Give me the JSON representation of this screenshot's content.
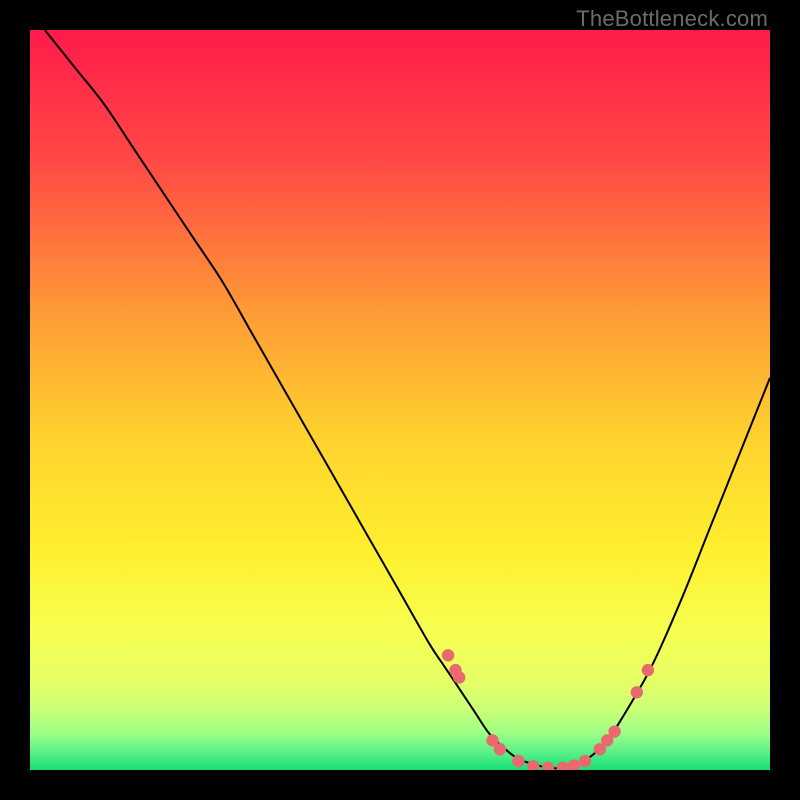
{
  "watermark": "TheBottleneck.com",
  "colors": {
    "frame": "#000000",
    "curve": "#000000",
    "dot_fill": "#e86a6f",
    "dot_stroke": "#d84a50",
    "grad_top": "#ff1b4b",
    "grad_mid1": "#ff6a3a",
    "grad_mid2": "#ffb92e",
    "grad_mid3": "#ffe531",
    "grad_mid4": "#f7ff4d",
    "grad_mid5": "#d8ff70",
    "grad_bottom": "#16e072"
  },
  "chart_data": {
    "type": "line",
    "title": "",
    "xlabel": "",
    "ylabel": "",
    "xlim": [
      0,
      100
    ],
    "ylim": [
      0,
      100
    ],
    "series": [
      {
        "name": "curve",
        "x": [
          2,
          6,
          10,
          14,
          18,
          22,
          26,
          30,
          34,
          38,
          42,
          46,
          50,
          54,
          56,
          58,
          60,
          62,
          64,
          66,
          68,
          70,
          72,
          74,
          76,
          78,
          80,
          84,
          88,
          92,
          96,
          100
        ],
        "y": [
          100,
          95,
          90,
          84,
          78,
          72,
          66,
          59,
          52,
          45,
          38,
          31,
          24,
          17,
          14,
          11,
          8,
          5,
          3,
          1.5,
          0.8,
          0.3,
          0.3,
          0.8,
          2,
          4,
          7,
          14,
          23,
          33,
          43,
          53
        ]
      }
    ],
    "dots": [
      {
        "x": 56.5,
        "y": 15.5
      },
      {
        "x": 57.5,
        "y": 13.5
      },
      {
        "x": 58.0,
        "y": 12.5
      },
      {
        "x": 62.5,
        "y": 4.0
      },
      {
        "x": 63.5,
        "y": 2.8
      },
      {
        "x": 66.0,
        "y": 1.2
      },
      {
        "x": 68.0,
        "y": 0.5
      },
      {
        "x": 70.0,
        "y": 0.3
      },
      {
        "x": 72.0,
        "y": 0.3
      },
      {
        "x": 73.5,
        "y": 0.6
      },
      {
        "x": 75.0,
        "y": 1.2
      },
      {
        "x": 77.0,
        "y": 2.8
      },
      {
        "x": 78.0,
        "y": 4.0
      },
      {
        "x": 79.0,
        "y": 5.2
      },
      {
        "x": 82.0,
        "y": 10.5
      },
      {
        "x": 83.5,
        "y": 13.5
      }
    ]
  }
}
